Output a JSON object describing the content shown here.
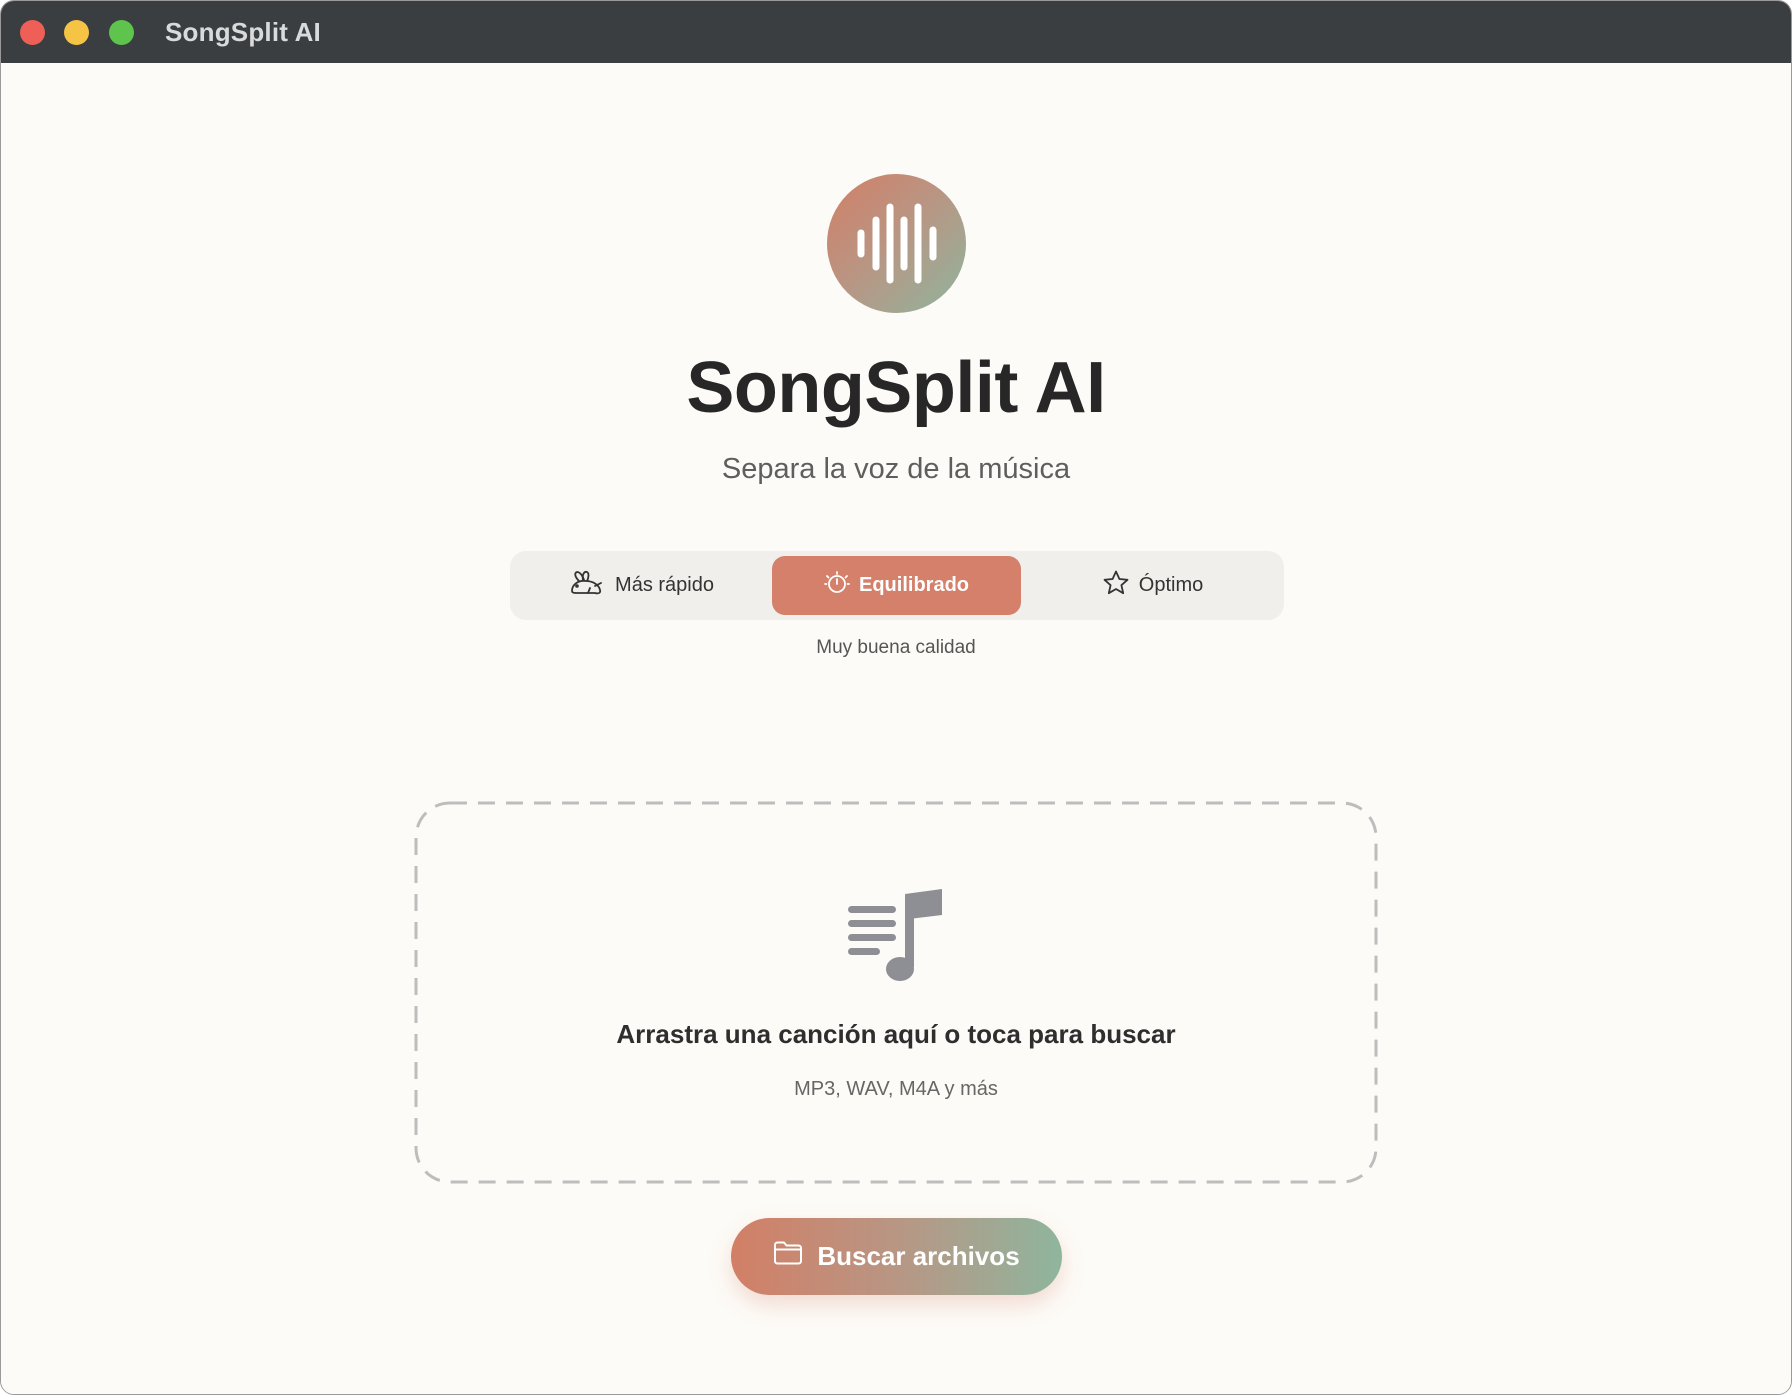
{
  "window": {
    "title": "SongSplit AI"
  },
  "header": {
    "logo_icon": "waveform-icon",
    "title": "SongSplit AI",
    "subtitle": "Separa la voz de la música"
  },
  "quality_selector": {
    "options": [
      {
        "label": "Más rápido",
        "icon": "rabbit-icon",
        "selected": false
      },
      {
        "label": "Equilibrado",
        "icon": "timer-icon",
        "selected": true
      },
      {
        "label": "Óptimo",
        "icon": "star-icon",
        "selected": false
      }
    ],
    "description": "Muy buena calidad"
  },
  "dropzone": {
    "icon": "music-list-icon",
    "title": "Arrastra una canción aquí o toca para buscar",
    "formats": "MP3, WAV, M4A y más"
  },
  "browse_button": {
    "icon": "folder-icon",
    "label": "Buscar archivos"
  },
  "colors": {
    "accent": "#d4806a",
    "accent_green": "#8fb59d",
    "background": "#fdfbf7",
    "titlebar": "#3a3e40"
  }
}
